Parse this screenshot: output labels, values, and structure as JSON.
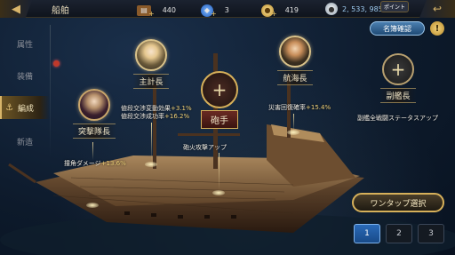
{
  "header": {
    "title": "船舶",
    "resources": [
      {
        "icon": "chest-icon",
        "value": "440"
      },
      {
        "icon": "potion-icon",
        "value": "3"
      },
      {
        "icon": "gold-coin-icon",
        "value": "419"
      },
      {
        "icon": "silver-coin-icon",
        "value": "2, 533, 985"
      }
    ],
    "point_label": "ポイント"
  },
  "sidebar": {
    "items": [
      {
        "label": "属性"
      },
      {
        "label": "装備"
      },
      {
        "label": "編成"
      },
      {
        "label": "新造"
      }
    ]
  },
  "buttons": {
    "name_confirm": "名簿確認",
    "info": "!",
    "one_tap": "ワンタップ選択"
  },
  "crew": {
    "captain": {
      "label": "突撃隊長",
      "stat_name": "撞角ダメージ",
      "stat_value": "+13.6%"
    },
    "purser": {
      "label": "主計長",
      "stat1_name": "値段交渉変動効果",
      "stat1_value": "+3.1%",
      "stat2_name": "値段交渉成功率",
      "stat2_value": "+16.2%"
    },
    "gunner": {
      "label": "砲手",
      "stat_name": "砲火攻撃アップ",
      "plus": "+"
    },
    "navigator": {
      "label": "航海長",
      "stat_name": "災害回復確率",
      "stat_value": "+15.4%"
    },
    "commander": {
      "label": "副艦長",
      "stat_name": "副艦全戦闘ステータスアップ",
      "plus": "+"
    }
  },
  "pagination": [
    "1",
    "2",
    "3"
  ],
  "colors": {
    "accent_gold": "#d6b05a",
    "stat_value": "#f2d37a",
    "active_page": "#2a6ab8"
  }
}
